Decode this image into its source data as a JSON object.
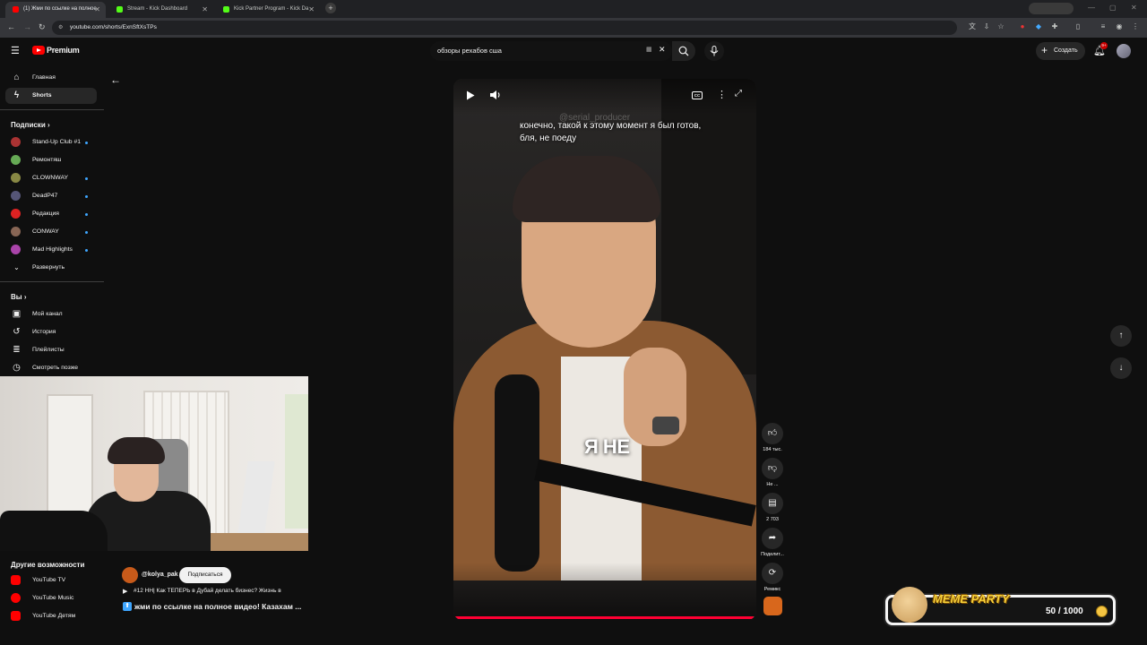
{
  "browser": {
    "tabs": [
      {
        "label": "(1) Жми по ссылке на полное",
        "active": true,
        "color": "#ff0000"
      },
      {
        "label": "Stream - Kick Dashboard",
        "active": false,
        "color": "#53fc18"
      },
      {
        "label": "Kick Partner Program - Kick Da",
        "active": false,
        "color": "#53fc18"
      }
    ],
    "url": "youtube.com/shorts/ExnSftXsTPs",
    "new_tab": "+"
  },
  "header": {
    "logo_text": "Premium",
    "search_query": "обзоры рехабов сша",
    "create_label": "Создать",
    "notif_count": "9+"
  },
  "sidebar": {
    "main": [
      {
        "label": "Главная",
        "icon": "home-icon"
      },
      {
        "label": "Shorts",
        "icon": "shorts-icon",
        "active": true
      }
    ],
    "subs_title": "Подписки",
    "subs": [
      {
        "label": "Stand-Up Club #1",
        "color": "#a33",
        "dot": true
      },
      {
        "label": "Ремонтяш",
        "color": "#6a5",
        "dot": false
      },
      {
        "label": "CLOWNWAY",
        "color": "#884",
        "dot": true
      },
      {
        "label": "DeadP47",
        "color": "#557",
        "dot": true
      },
      {
        "label": "Редакция",
        "color": "#d22",
        "dot": true
      },
      {
        "label": "CONWAY",
        "color": "#865",
        "dot": true
      },
      {
        "label": "Mad Highlights",
        "color": "#a4a",
        "dot": true
      }
    ],
    "expand_label": "Развернуть",
    "you_title": "Вы",
    "you_items": [
      {
        "label": "Мой канал",
        "icon": "channel-icon"
      },
      {
        "label": "История",
        "icon": "history-icon"
      },
      {
        "label": "Плейлисты",
        "icon": "playlists-icon"
      },
      {
        "label": "Смотреть позже",
        "icon": "watch-later-icon"
      }
    ],
    "more_title": "Другие возможности",
    "more_items": [
      {
        "label": "YouTube TV"
      },
      {
        "label": "YouTube Music"
      },
      {
        "label": "YouTube Детям"
      }
    ]
  },
  "short": {
    "subtitle": "конечно, такой к этому момент я был готов, бля, не поеду",
    "watermark": "@serial_producer",
    "caption_overlay": "Я НЕ",
    "channel": "@kolya_pak",
    "subscribe_label": "Подписаться",
    "related_title": "#12 НН| Как ТЕПЕРЬ в Дубай делать бизнес? Жизнь в",
    "title": "жми по ссылке на полное видео! Казахам ...",
    "progress": 0.99,
    "likes": "184 тыс.",
    "dislike_label": "Не ...",
    "comments": "2 703",
    "share_label": "Поделит...",
    "remix_label": "Ремикс"
  },
  "overlay": {
    "title": "MEME PARTY",
    "counter": "50 / 1000"
  }
}
